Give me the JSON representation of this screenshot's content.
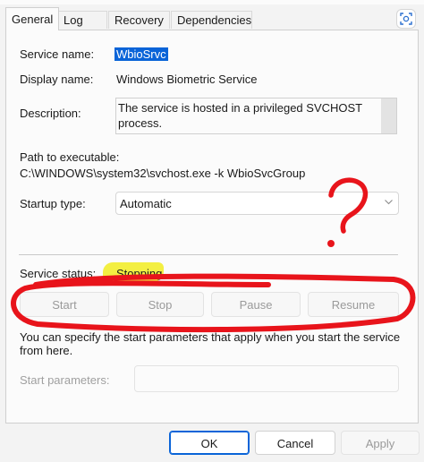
{
  "tabs": [
    "General",
    "Log On",
    "Recovery",
    "Dependencies"
  ],
  "active_tab": "General",
  "icons": {
    "corner_button": "screen-capture-icon",
    "dropdown": "chevron-down-icon"
  },
  "fields": {
    "service_name_label": "Service name:",
    "service_name_value": "WbioSrvc",
    "display_name_label": "Display name:",
    "display_name_value": "Windows Biometric Service",
    "description_label": "Description:",
    "description_value": "The service is hosted in a privileged SVCHOST process.",
    "path_label": "Path to executable:",
    "path_value": "C:\\WINDOWS\\system32\\svchost.exe -k WbioSvcGroup",
    "startup_type_label": "Startup type:",
    "startup_type_value": "Automatic",
    "service_status_label": "Service status:",
    "service_status_value": "Stopping"
  },
  "service_buttons": [
    "Start",
    "Stop",
    "Pause",
    "Resume"
  ],
  "hint_text": "You can specify the start parameters that apply when you start the service from here.",
  "start_params_label": "Start parameters:",
  "start_params_value": "",
  "footer": {
    "ok": "OK",
    "cancel": "Cancel",
    "apply": "Apply"
  },
  "colors": {
    "accent": "#0a64d8",
    "highlight": "#f2ee38",
    "annotation_red": "#e8141b"
  }
}
